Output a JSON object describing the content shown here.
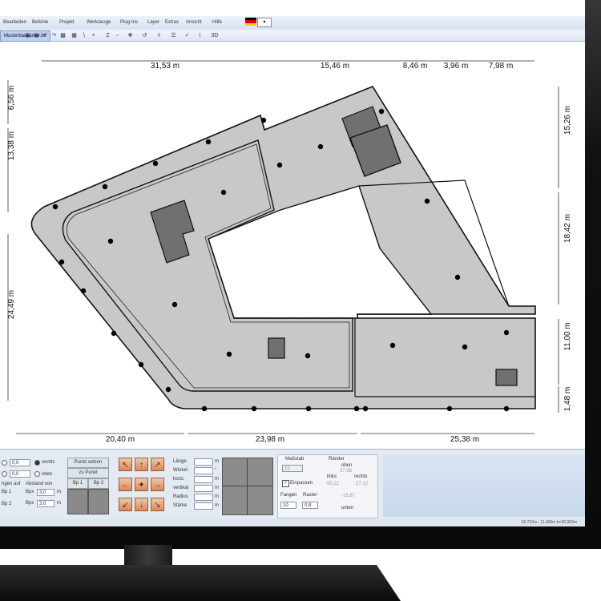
{
  "menu": [
    "Bearbeiten",
    "Befehle",
    "Projekt",
    "Werkzeuge",
    "Plug-Ins",
    "Layer",
    "Extras",
    "Ansicht",
    "Hilfe"
  ],
  "doc_tab": "Musterbaukamer.bx",
  "toolbar_icons": [
    "open-icon",
    "save-icon",
    "undo-icon",
    "redo-icon",
    "print-icon",
    "hatch-icon",
    "line-icon",
    "point-icon",
    "zoom-icon",
    "select-icon",
    "pan-icon",
    "measure-icon",
    "check-icon",
    "info-icon",
    "3d-icon"
  ],
  "toolbar_3d": "3D",
  "dimensions": {
    "top": [
      "31,53 m",
      "15,46 m",
      "8,46 m",
      "3,96 m",
      "7,98 m"
    ],
    "bottom": [
      "20,40 m",
      "23,98 m",
      "25,38 m"
    ],
    "left": [
      "6,56 m",
      "13,38 m",
      "24,49 m"
    ],
    "right": [
      "15,26 m",
      "18,42 m",
      "11,00 m",
      "1,48 m"
    ]
  },
  "panel": {
    "value1": "0,0",
    "value2": "0,0",
    "radio_right": "rechts",
    "radio_top": "oben",
    "point_button": "Punkt setzen",
    "by_point": "zu Punkt",
    "bp1": "Bp 1",
    "bp2": "Bp 2",
    "offset_label": "Abstand von",
    "offset_label_prefix": "ngen auf",
    "bp1_short": "Bp 1",
    "bp2_short": "Bp 2",
    "bpx1": "Bpx",
    "bpx2": "Bpx",
    "bpx1_value": "3,0",
    "bpx2_value": "3,0",
    "unit_m": "m",
    "props": [
      "Länge",
      "Winkel",
      "horiz.",
      "vertikal",
      "Radius",
      "Stärke"
    ],
    "props_units": [
      "m",
      "°",
      "m",
      "m",
      "m",
      "m"
    ],
    "scale_label": "Maßstab",
    "scale_value": "15",
    "edges_label": "Ränder",
    "edges_top": "oben",
    "edges_top_value": "37,88",
    "edges_left": "links",
    "edges_right": "rechts",
    "edges_left_value": "-50,22",
    "edges_right_value": "27,12",
    "edges_bottom_value": "-15,67",
    "edges_bottom": "unten",
    "snap_label": "Einpassen",
    "catch_label": "Fangen",
    "grid_label": "Raster",
    "catch_value": "10",
    "grid_value": "0,8"
  },
  "status": "56,763m ; 11,466m b=36,969m",
  "colors": {
    "accent": "#bcd2ee",
    "building": "#c8c8c8",
    "dark_block": "#707070"
  }
}
